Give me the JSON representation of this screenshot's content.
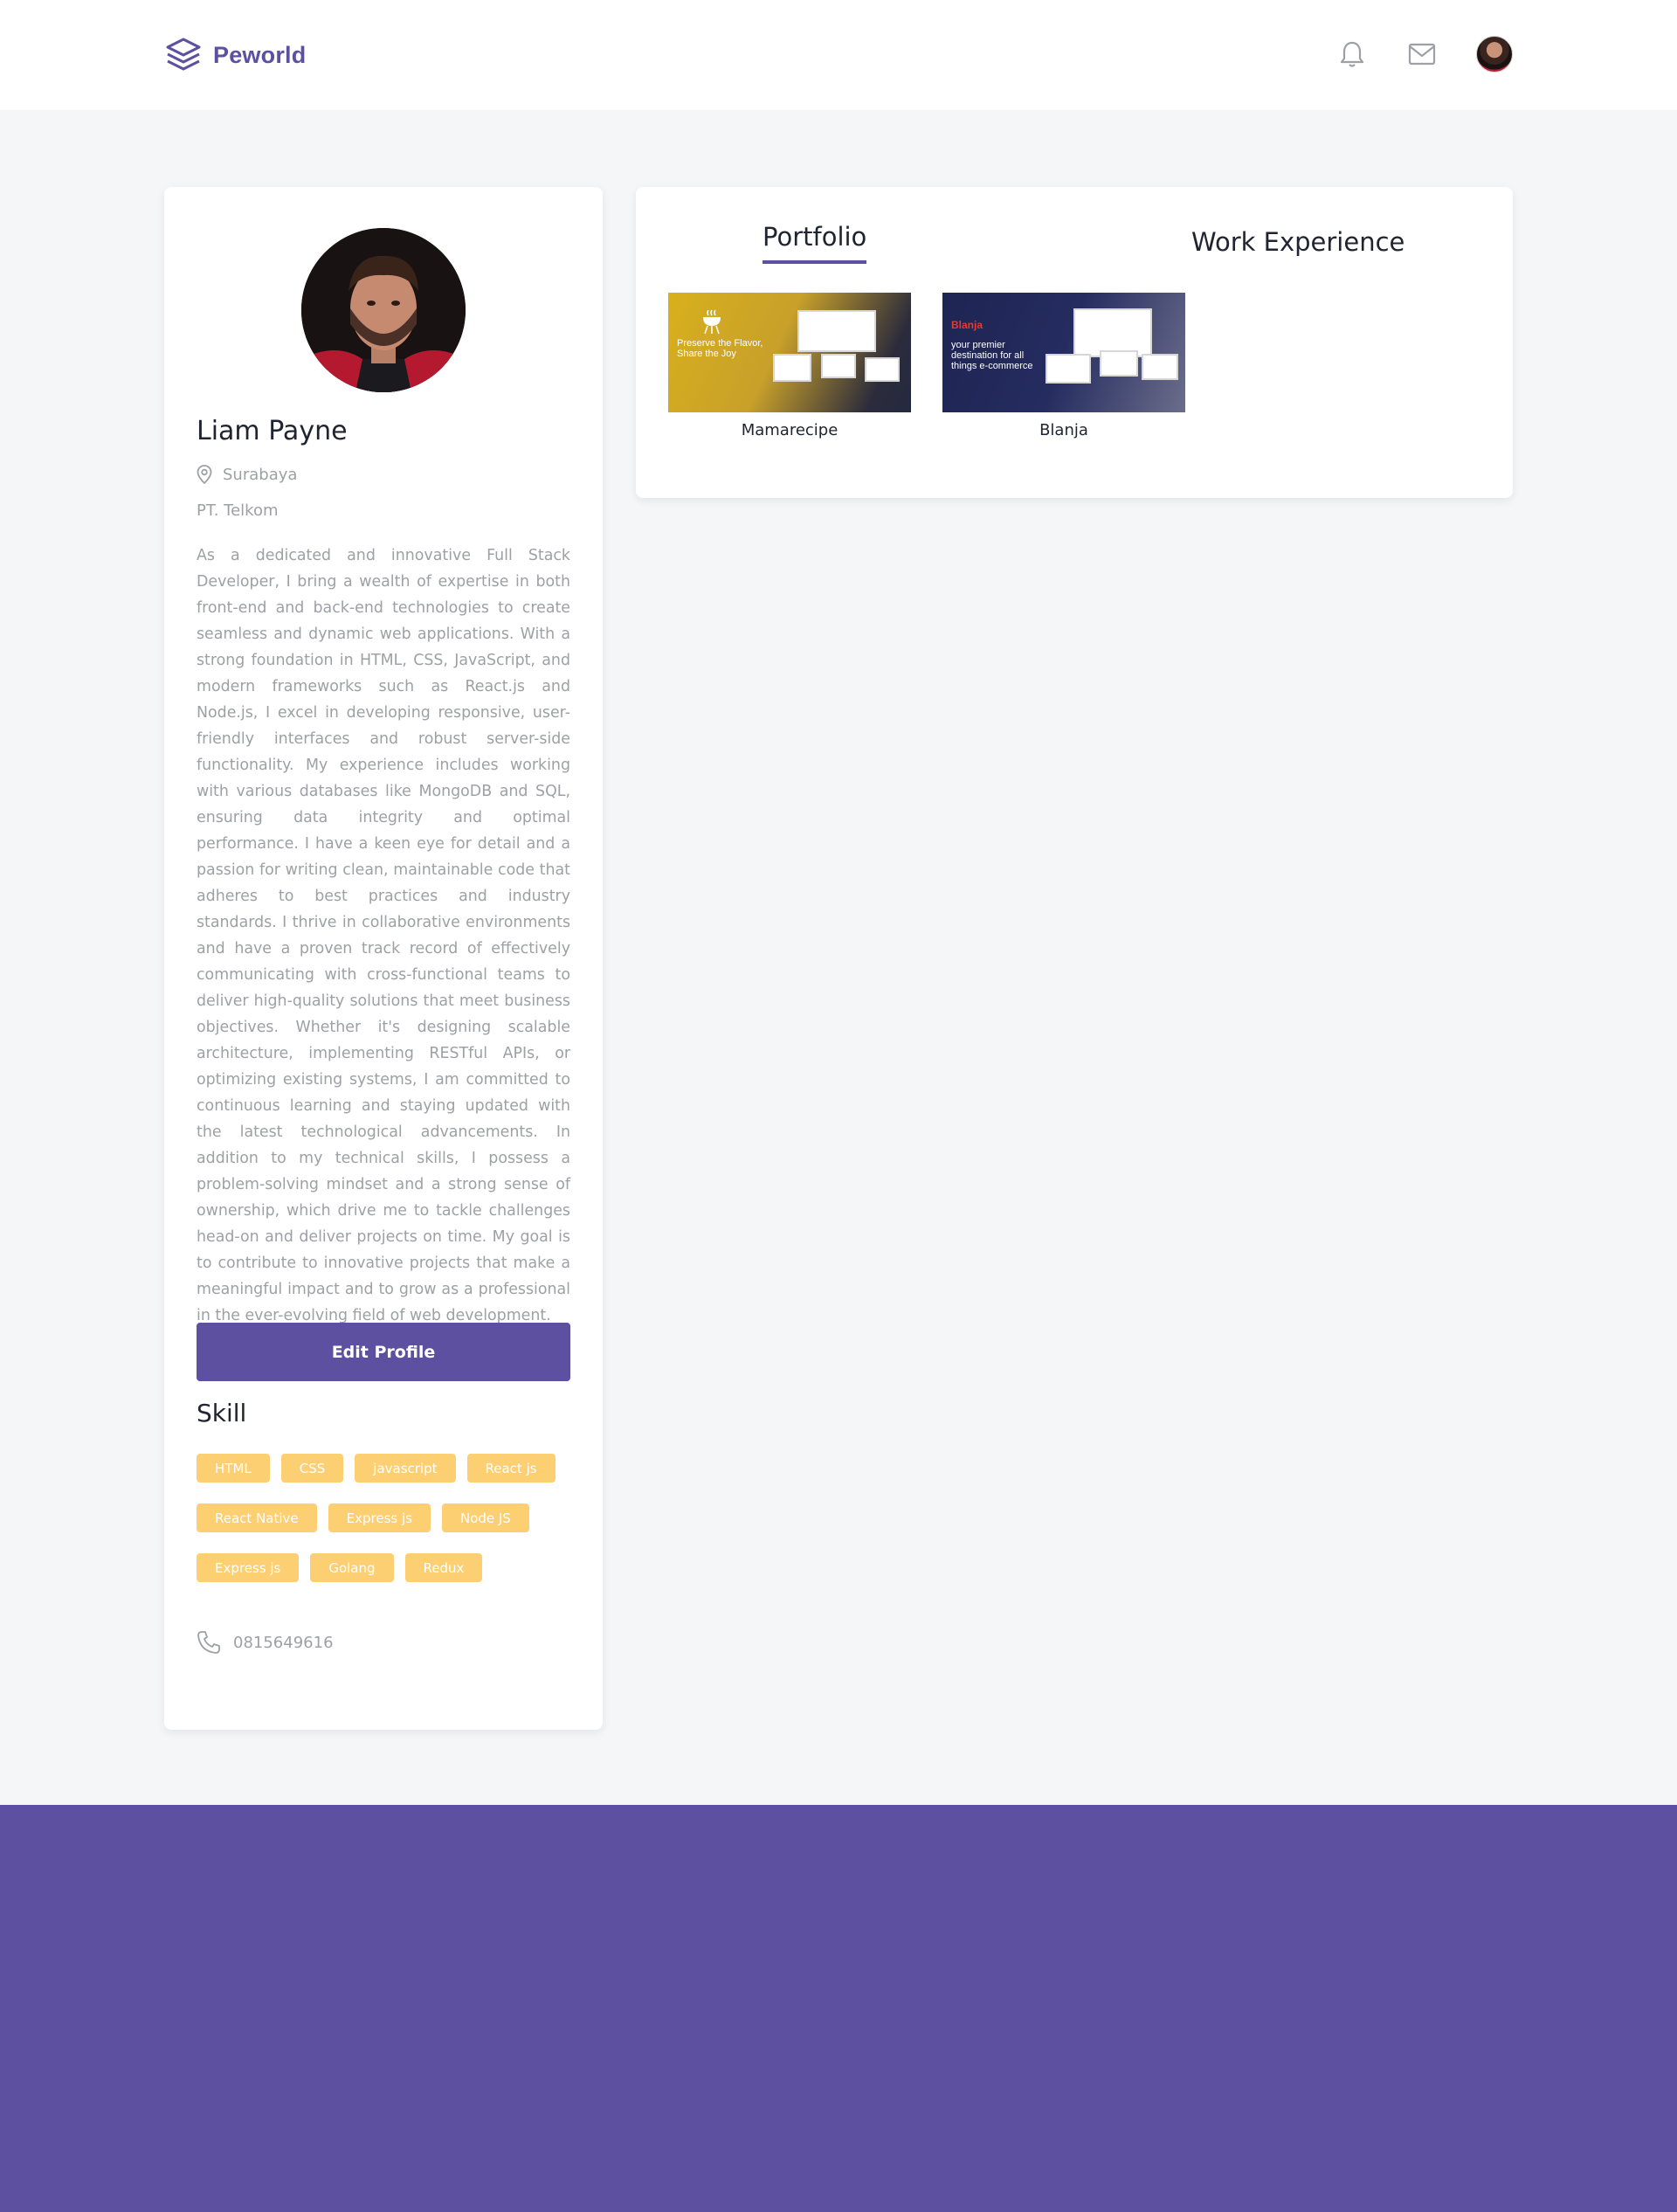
{
  "brand": {
    "name": "Peworld"
  },
  "profile": {
    "name": "Liam Payne",
    "location": "Surabaya",
    "company": "PT. Telkom",
    "bio": "As a dedicated and innovative Full Stack Developer, I bring a wealth of expertise in both front-end and back-end technologies to create seamless and dynamic web applications. With a strong foundation in HTML, CSS, JavaScript, and modern frameworks such as React.js and Node.js, I excel in developing responsive, user-friendly interfaces and robust server-side functionality. My experience includes working with various databases like MongoDB and SQL, ensuring data integrity and optimal performance. I have a keen eye for detail and a passion for writing clean, maintainable code that adheres to best practices and industry standards. I thrive in collaborative environments and have a proven track record of effectively communicating with cross-functional teams to deliver high-quality solutions that meet business objectives. Whether it's designing scalable architecture, implementing RESTful APIs, or optimizing existing systems, I am committed to continuous learning and staying updated with the latest technological advancements. In addition to my technical skills, I possess a problem-solving mindset and a strong sense of ownership, which drive me to tackle challenges head-on and deliver projects on time. My goal is to contribute to innovative projects that make a meaningful impact and to grow as a professional in the ever-evolving field of web development.",
    "edit_label": "Edit Profile",
    "skill_title": "Skill",
    "skills": [
      [
        "HTML",
        "CSS",
        "javascript",
        "React js"
      ],
      [
        "React Native",
        "Express js",
        "Node JS"
      ],
      [
        "Express js",
        "Golang",
        "Redux"
      ]
    ],
    "phone": "0815649616"
  },
  "tabs": {
    "portfolio": "Portfolio",
    "work": "Work Experience"
  },
  "projects": [
    {
      "label": "Mamarecipe",
      "caption": "Preserve the Flavor, Share the Joy"
    },
    {
      "label": "Blanja",
      "caption": "your premier destination for all things e-commerce",
      "brand": "Blanja"
    }
  ],
  "colors": {
    "primary": "#5e50a1",
    "chip": "#fbb017",
    "muted": "#9ea0a5"
  }
}
